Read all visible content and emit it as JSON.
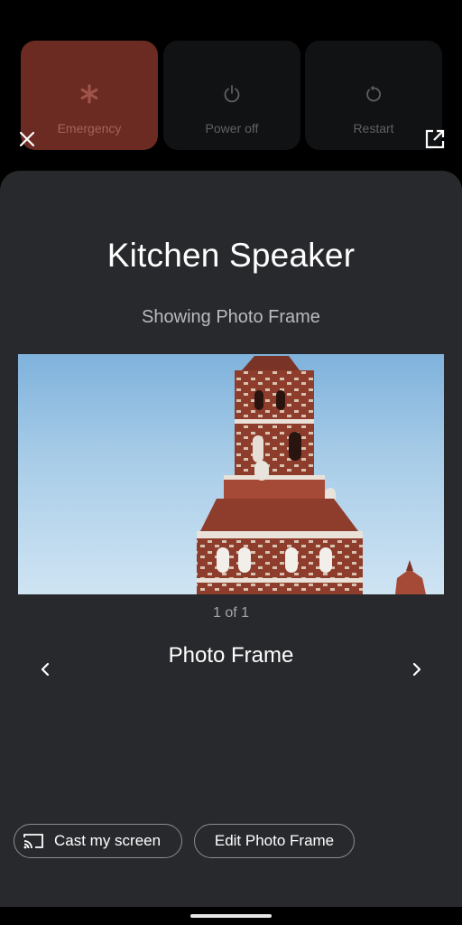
{
  "power_menu": {
    "emergency_label": "Emergency",
    "power_off_label": "Power off",
    "restart_label": "Restart",
    "emergency_color": "#6b2a22"
  },
  "top_icons": {
    "close": "close-icon",
    "open_external": "open-in-new-icon"
  },
  "sheet": {
    "title": "Kitchen Speaker",
    "subtitle": "Showing Photo Frame",
    "photo": "photo-of-brick-tower",
    "counter": "1 of 1",
    "frame_name": "Photo Frame",
    "prev_icon": "chevron-left-icon",
    "next_icon": "chevron-right-icon",
    "background_color": "#27292c"
  },
  "actions": {
    "cast_label": "Cast my screen",
    "edit_label": "Edit Photo Frame",
    "cast_icon": "cast-icon"
  }
}
